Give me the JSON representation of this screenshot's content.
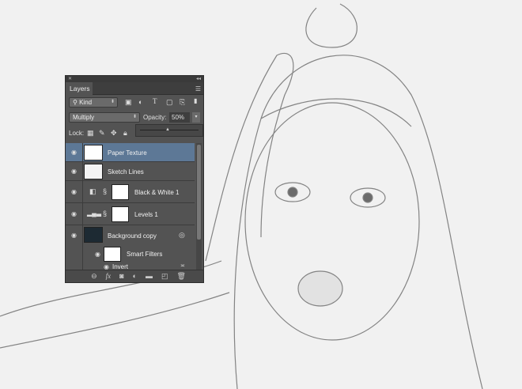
{
  "panel": {
    "close_icon": "close-icon",
    "collapse_icon": "double-chevron-icon",
    "tab_label": "Layers",
    "filter": {
      "value": "Kind",
      "icons": [
        "image-filter-icon",
        "adjustment-filter-icon",
        "type-filter-icon",
        "shape-filter-icon",
        "smart-object-filter-icon"
      ]
    },
    "blend_mode": "Multiply",
    "opacity_label": "Opacity:",
    "opacity_value": "50%",
    "opacity_slider": 0.5,
    "lock_label": "Lock:",
    "layers": [
      {
        "name": "Paper Texture",
        "selected": true,
        "visible": true
      },
      {
        "name": "Sketch Lines",
        "selected": false,
        "visible": true
      },
      {
        "name": "Black & White 1",
        "type": "adjustment",
        "visible": true
      },
      {
        "name": "Levels 1",
        "type": "adjustment",
        "visible": true
      },
      {
        "name": "Background copy",
        "type": "smart-object",
        "visible": true
      },
      {
        "name": "Smart Filters",
        "visible": true
      },
      {
        "name": "Invert",
        "visible": true
      }
    ],
    "bottom_icons": [
      "link-icon",
      "fx-icon",
      "mask-icon",
      "adjustment-icon",
      "folder-icon",
      "new-layer-icon",
      "trash-icon"
    ]
  }
}
